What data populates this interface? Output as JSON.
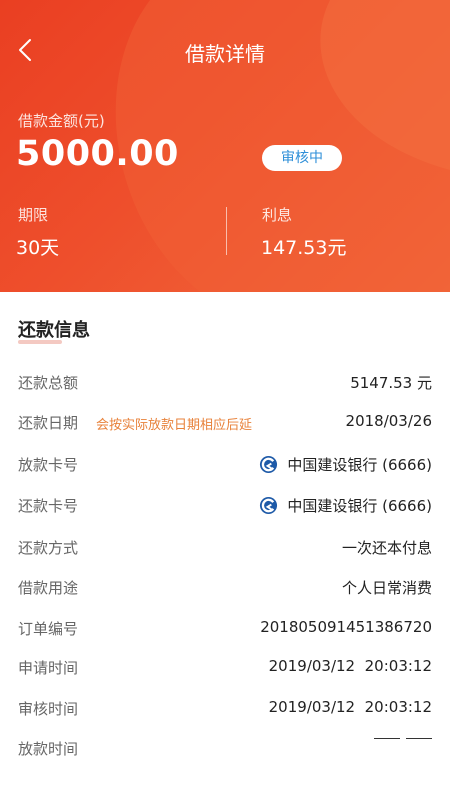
{
  "header": {
    "title": "借款详情",
    "amount_label": "借款金额(元)",
    "amount_value": "5000.00",
    "status": "审核中",
    "period_label": "期限",
    "period_value": "30天",
    "interest_label": "利息",
    "interest_value": "147.53元",
    "colors": {
      "gradient_start": "#ea3f22",
      "gradient_end": "#f26a3c",
      "badge_text": "#2f8fd8"
    },
    "back_icon": "chevron-left-icon"
  },
  "repayment": {
    "section_title": "还款信息",
    "rows": [
      {
        "label": "还款总额",
        "note": "",
        "value": "5147.53 元"
      },
      {
        "label": "还款日期",
        "note": "会按实际放款日期相应后延",
        "value": "2018/03/26"
      },
      {
        "label": "放款卡号",
        "note": "",
        "value": "中国建设银行 (6666)",
        "icon": "bank-logo-icon"
      },
      {
        "label": "还款卡号",
        "note": "",
        "value": "中国建设银行 (6666)",
        "icon": "bank-logo-icon"
      },
      {
        "label": "还款方式",
        "note": "",
        "value": "一次还本付息"
      },
      {
        "label": "借款用途",
        "note": "",
        "value": "个人日常消费"
      },
      {
        "label": "订单编号",
        "note": "",
        "value": "201805091451386720"
      },
      {
        "label": "申请时间",
        "note": "",
        "value": "2019/03/12  20:03:12"
      },
      {
        "label": "审核时间",
        "note": "",
        "value": "2019/03/12  20:03:12"
      },
      {
        "label": "放款时间",
        "note": "",
        "value": ""
      }
    ],
    "note_color": "#e8823b",
    "bank_icon_color": "#1e5aa8"
  }
}
